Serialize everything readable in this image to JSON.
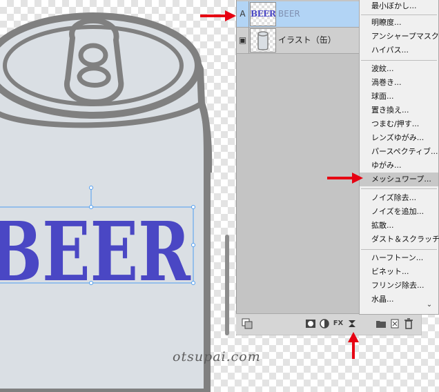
{
  "canvas": {
    "beer_text": "BEER",
    "colors": {
      "can_body": "#dadfe4",
      "can_outline": "#808080",
      "text": "#4a47c4",
      "selection": "#4e9cf0"
    }
  },
  "layers": [
    {
      "type_icon": "A",
      "thumb_label": "BEER",
      "name": "BEER",
      "selected": true
    },
    {
      "type_icon": "▣",
      "thumb_label": "",
      "name": "イラスト（缶）",
      "selected": false
    }
  ],
  "toolbar": {
    "icons": [
      "link-layers-icon",
      "layer-mask-icon",
      "adjustment-layer-icon",
      "fx-icon",
      "mesh-warp-icon",
      "new-folder-icon",
      "new-layer-icon",
      "trash-icon"
    ],
    "fx_label": "FX"
  },
  "filter_menu": {
    "groups": [
      [
        "最小ぼかし..."
      ],
      [
        "明瞭度...",
        "アンシャープマスク...",
        "ハイパス..."
      ],
      [
        "波紋...",
        "渦巻き...",
        "球面...",
        "置き換え...",
        "つまむ/押す...",
        "レンズゆがみ...",
        "パースペクティブ...",
        "ゆがみ...",
        "メッシュワープ..."
      ],
      [
        "ノイズ除去...",
        "ノイズを追加...",
        "拡散...",
        "ダスト＆スクラッチ..."
      ],
      [
        "ハーフトーン...",
        "ビネット...",
        "フリンジ除去...",
        "水晶..."
      ]
    ],
    "highlighted": "メッシュワープ...",
    "more_icon": "⌄"
  },
  "watermark": "otsupai.com",
  "annotation_color": "#e60012"
}
